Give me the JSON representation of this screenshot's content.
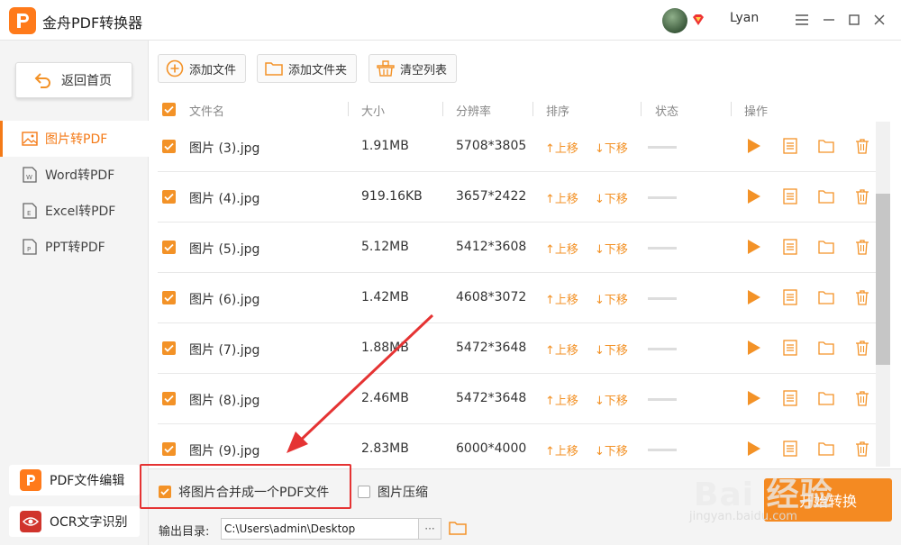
{
  "app": {
    "title": "金舟PDF转换器",
    "username": "Lyan"
  },
  "colors": {
    "accent": "#f39227",
    "highlight": "#e53333"
  },
  "sidebar": {
    "back_label": "返回首页",
    "items": [
      {
        "label": "图片转PDF",
        "icon": "image-icon"
      },
      {
        "label": "Word转PDF",
        "icon": "word-doc-icon"
      },
      {
        "label": "Excel转PDF",
        "icon": "excel-doc-icon"
      },
      {
        "label": "PPT转PDF",
        "icon": "ppt-doc-icon"
      }
    ],
    "bottom": [
      {
        "label": "PDF文件编辑",
        "icon": "pdf-edit-icon"
      },
      {
        "label": "OCR文字识别",
        "icon": "ocr-eye-icon"
      }
    ]
  },
  "toolbar": {
    "add_file": "添加文件",
    "add_folder": "添加文件夹",
    "clear_list": "清空列表"
  },
  "table": {
    "headers": {
      "name": "文件名",
      "size": "大小",
      "resolution": "分辨率",
      "sort": "排序",
      "status": "状态",
      "action": "操作"
    },
    "move_up": "上移",
    "move_down": "下移",
    "rows": [
      {
        "name": "图片 (3).jpg",
        "size": "1.91MB",
        "res": "5708*3805"
      },
      {
        "name": "图片 (4).jpg",
        "size": "919.16KB",
        "res": "3657*2422"
      },
      {
        "name": "图片 (5).jpg",
        "size": "5.12MB",
        "res": "5412*3608"
      },
      {
        "name": "图片 (6).jpg",
        "size": "1.42MB",
        "res": "4608*3072"
      },
      {
        "name": "图片 (7).jpg",
        "size": "1.88MB",
        "res": "5472*3648"
      },
      {
        "name": "图片 (8).jpg",
        "size": "2.46MB",
        "res": "5472*3648"
      },
      {
        "name": "图片 (9).jpg",
        "size": "2.83MB",
        "res": "6000*4000"
      }
    ]
  },
  "footer": {
    "merge_label": "将图片合并成一个PDF文件",
    "merge_checked": true,
    "compress_label": "图片压缩",
    "compress_checked": false,
    "output_label": "输出目录:",
    "output_path": "C:\\Users\\admin\\Desktop",
    "more_label": "···",
    "start_label": "开始转换"
  },
  "watermark": {
    "main": "Bai 经验",
    "sub": "jingyan.baidu.com"
  }
}
